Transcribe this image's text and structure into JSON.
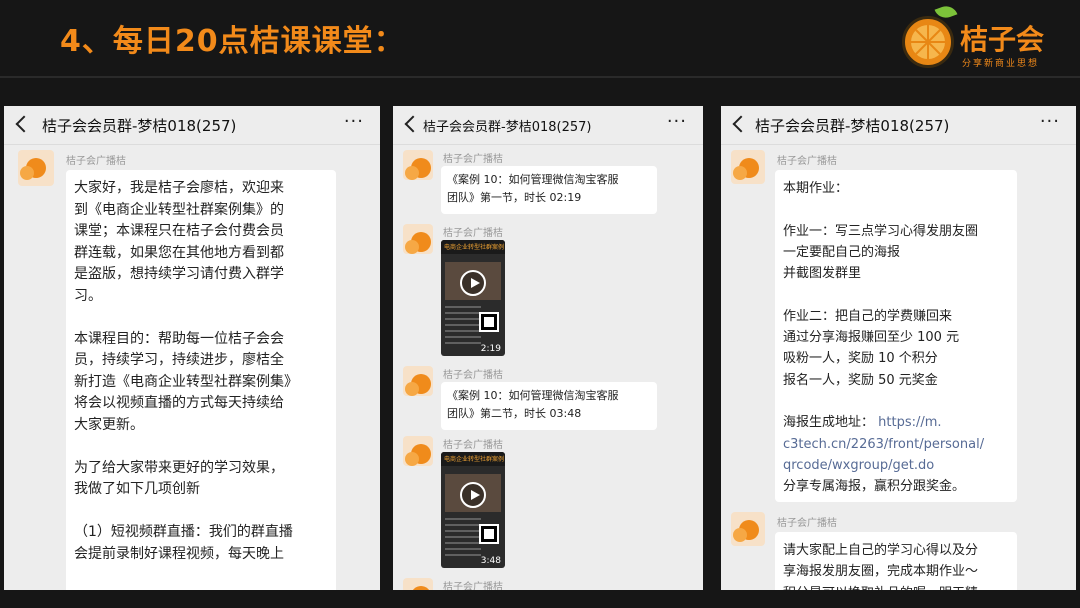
{
  "slide": {
    "title": "4、每日20点桔课课堂："
  },
  "brand": {
    "name": "桔子会",
    "slogan": "分享新商业思想",
    "logo_icon": "orange-slice-logo-icon",
    "accent": "#f28a1a"
  },
  "chat": {
    "group_title": "桔子会会员群-梦桔018(257)",
    "sender_name": "桔子会广播桔",
    "more_icon": "ellipsis-icon",
    "back_icon": "chevron-left-icon"
  },
  "left_panel": {
    "message": "大家好，我是桔子会廖桔，欢迎来\n到《电商企业转型社群案例集》的\n课堂；本课程只在桔子会付费会员\n群连载，如果您在其他地方看到都\n是盗版，想持续学习请付费入群学\n习。\n\n本课程目的：帮助每一位桔子会会\n员，持续学习，持续进步，廖桔全\n新打造《电商企业转型社群案例集》\n将会以视频直播的方式每天持续给\n大家更新。\n\n为了给大家带来更好的学习效果，\n我做了如下几项创新\n\n（1）短视频群直播：我们的群直播\n会提前录制好课程视频，每天晚上"
  },
  "middle_panel": {
    "msg1": "《案例 10：如何管理微信淘宝客服\n团队》第一节，时长 02:19",
    "video1": {
      "heading": "电商企业转型社群案例",
      "duration": "2:19"
    },
    "msg2": "《案例 10：如何管理微信淘宝客服\n团队》第二节，时长 03:48",
    "video2": {
      "heading": "电商企业转型社群案例",
      "duration": "3:48"
    }
  },
  "right_panel": {
    "msg_part1": "本期作业：\n\n作业一：写三点学习心得发朋友圈\n一定要配自己的海报\n并截图发群里\n\n作业二：把自己的学费赚回来\n通过分享海报赚回至少 100 元\n吸粉一人，奖励 10 个积分\n报名一人，奖励 50 元奖金\n\n海报生成地址：",
    "link": "https://m.\nc3tech.cn/2263/front/personal/\nqrcode/wxgroup/get.do",
    "msg_part2": "\n分享专属海报，赢积分跟奖金。",
    "msg3": "请大家配上自己的学习心得以及分\n享海报发朋友圈，完成本期作业～\n积分是可以换取礼品的喔～明天精"
  }
}
